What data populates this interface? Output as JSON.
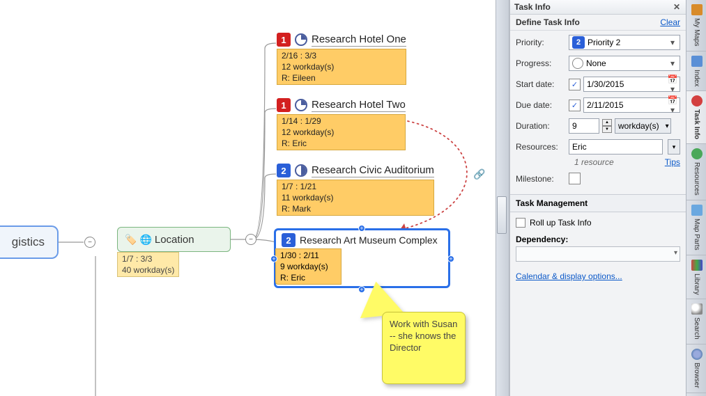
{
  "root": {
    "label": "gistics",
    "dates": "1/7 : 3/3",
    "workdays": "40 workday(s)"
  },
  "location": {
    "label": "Location"
  },
  "tasks": [
    {
      "priority": 1,
      "progress": "0",
      "title": "Research Hotel One",
      "dates": "2/16 : 3/3",
      "workdays": "12 workday(s)",
      "resource": "R: Eileen"
    },
    {
      "priority": 1,
      "progress": "0",
      "title": "Research Hotel Two",
      "dates": "1/14 : 1/29",
      "workdays": "12 workday(s)",
      "resource": "R: Eric"
    },
    {
      "priority": 2,
      "progress": "50",
      "title": "Research Civic Auditorium",
      "dates": "1/7 : 1/21",
      "workdays": "11 workday(s)",
      "resource": "R: Mark"
    }
  ],
  "selected": {
    "priority": 2,
    "title": "Research Art Museum Complex",
    "dates": "1/30 : 2/11",
    "workdays": "9 workday(s)",
    "resource": "R: Eric"
  },
  "callout": "Work with Susan -- she knows the Director",
  "panel": {
    "title": "Task Info",
    "subtitle": "Define Task Info",
    "clear": "Clear",
    "priority_label": "Priority:",
    "priority_value": "Priority 2",
    "progress_label": "Progress:",
    "progress_value": "None",
    "start_label": "Start date:",
    "start_value": "1/30/2015",
    "due_label": "Due date:",
    "due_value": "2/11/2015",
    "duration_label": "Duration:",
    "duration_value": "9",
    "duration_unit": "workday(s)",
    "resources_label": "Resources:",
    "resources_value": "Eric",
    "resources_note": "1 resource",
    "tips": "Tips",
    "milestone_label": "Milestone:",
    "task_mgmt": "Task Management",
    "rollup": "Roll up Task Info",
    "dependency": "Dependency:",
    "cal_link": "Calendar & display options..."
  },
  "tabs": [
    {
      "label": "My Maps"
    },
    {
      "label": "Index"
    },
    {
      "label": "Task Info"
    },
    {
      "label": "Resources"
    },
    {
      "label": "Map Parts"
    },
    {
      "label": "Library"
    },
    {
      "label": "Search"
    },
    {
      "label": "Browser"
    }
  ]
}
